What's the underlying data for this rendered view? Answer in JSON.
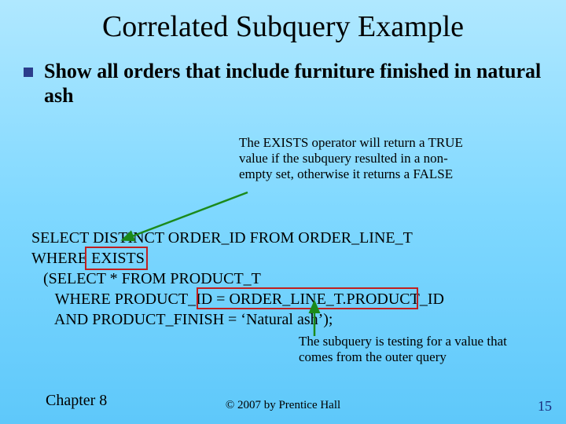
{
  "title": "Correlated Subquery Example",
  "bullet": "Show all orders that include furniture finished in natural ash",
  "callout_exists": "The EXISTS operator will return a TRUE value if the subquery resulted in a non-empty set, otherwise it returns a FALSE",
  "sql": {
    "l1": "SELECT DISTINCT ORDER_ID FROM ORDER_LINE_T",
    "l2": "WHERE EXISTS",
    "l3": "   (SELECT * FROM PRODUCT_T",
    "l4": "      WHERE PRODUCT_ID = ORDER_LINE_T.PRODUCT_ID",
    "l5": "      AND PRODUCT_FINISH = ‘Natural ash’);"
  },
  "callout_corr": "The subquery is testing for a value that comes from the outer query",
  "footer": {
    "chapter": "Chapter 8",
    "copyright": "© 2007 by Prentice Hall",
    "page": "15"
  }
}
